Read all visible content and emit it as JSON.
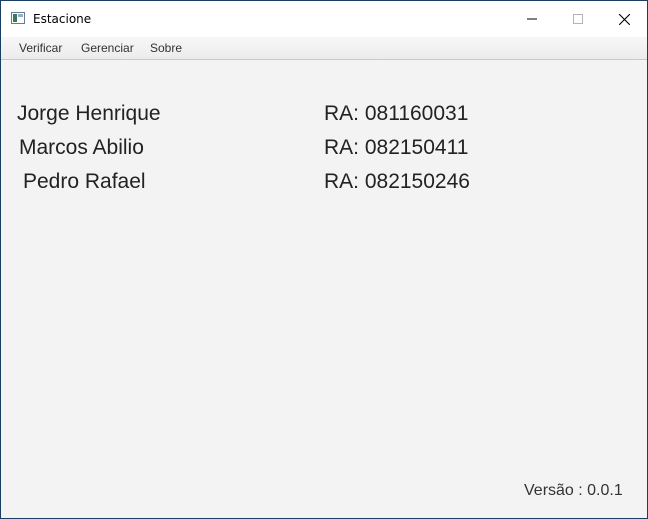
{
  "window": {
    "title": "Estacione",
    "icon": "app-window-icon",
    "controls": {
      "minimize_icon": "minimize-icon",
      "maximize_icon": "maximize-icon",
      "close_icon": "close-icon"
    }
  },
  "menu": {
    "items": [
      {
        "label": "Verificar"
      },
      {
        "label": "Gerenciar"
      },
      {
        "label": "Sobre"
      }
    ]
  },
  "about": {
    "members": [
      {
        "name": "Jorge Henrique",
        "ra": "RA: 081160031"
      },
      {
        "name": "Marcos Abilio",
        "ra": "RA: 082150411"
      },
      {
        "name": "Pedro Rafael",
        "ra": "RA: 082150246"
      }
    ],
    "version": "Versão : 0.0.1"
  },
  "colors": {
    "window_background": "#f3f3f3",
    "titlebar_background": "#ffffff",
    "text": "#222222",
    "desktop": "#2a5b8a"
  }
}
